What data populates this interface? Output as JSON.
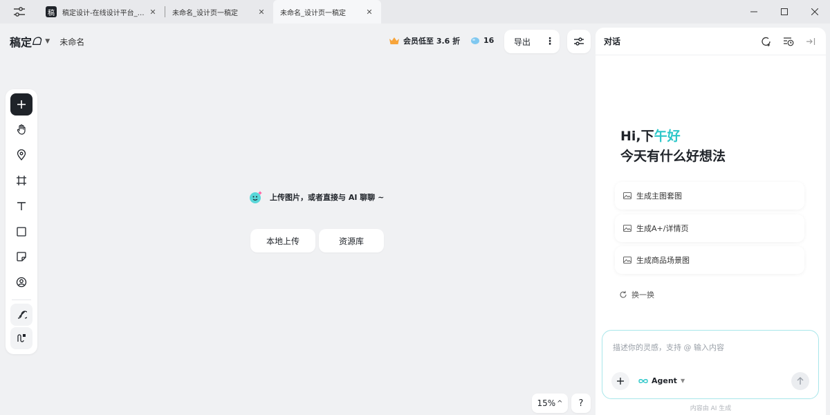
{
  "browser": {
    "tabs": [
      {
        "title": "稿定设计-在线设计平台_…",
        "favicon": "稿",
        "active": false
      },
      {
        "title": "未命名_设计页一稿定",
        "active": false
      },
      {
        "title": "未命名_设计页一稿定",
        "active": true
      }
    ],
    "close_glyph": "✕"
  },
  "header": {
    "logo": "稿定",
    "logo_glyph": "ᗝ",
    "doc_name": "未命名",
    "promo": "会员低至 3.6 折",
    "credits": "16",
    "export_label": "导出",
    "more_glyph": "⋮"
  },
  "canvas": {
    "hint": "上传图片，或者直接与 AI 聊聊 ~",
    "upload_local": "本地上传",
    "library": "资源库"
  },
  "footer": {
    "zoom": "15%",
    "zoom_chev": "^",
    "help": "?"
  },
  "panel": {
    "title": "对话",
    "greeting_prefix": "Hi,下",
    "greeting_accent": "午好",
    "greeting_line2": "今天有什么好想法",
    "suggestions": [
      "生成主图套图",
      "生成A+/详情页",
      "生成商品场景图"
    ],
    "refresh": "换一换",
    "input_placeholder": "描述你的灵感，支持 @ 输入内容",
    "agent_label": "Agent",
    "disclaimer": "内容由 AI 生成"
  },
  "colors": {
    "accent": "#2ec7c9",
    "dark": "#1f2329",
    "canvas_bg": "#f0f1f3"
  }
}
